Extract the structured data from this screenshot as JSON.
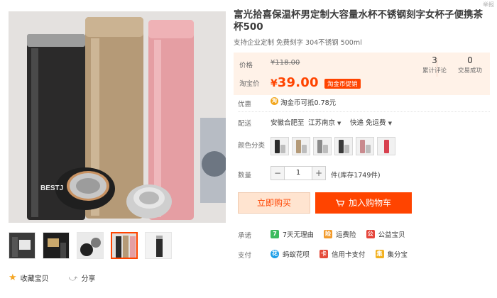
{
  "header": {
    "report_label": "举报"
  },
  "product": {
    "title": "富光拾喜保温杯男定制大容量水杯不锈钢刻字女杯子便携茶杯500",
    "subtitle": "支持企业定制 免费刻字 304不锈钢 500ml",
    "main_image_brand_text": "BESTJ"
  },
  "price": {
    "original_label": "价格",
    "original_value": "¥118.00",
    "current_label": "淘宝价",
    "current_symbol": "¥",
    "current_value": "39.00",
    "promo_tag": "淘金币促销",
    "stats": [
      {
        "count": "3",
        "label": "累计评论"
      },
      {
        "count": "0",
        "label": "交易成功"
      }
    ]
  },
  "promotion": {
    "label": "优惠",
    "coin_glyph": "淘",
    "text": "淘金币可抵0.78元"
  },
  "shipping": {
    "label": "配送",
    "from": "安徽合肥",
    "to_word": "至",
    "destination": "江苏南京",
    "method": "快递",
    "fee": "免运费"
  },
  "color": {
    "label": "颜色分类",
    "swatches": [
      {
        "name": "black",
        "color": "#2a2a2a"
      },
      {
        "name": "gold-open",
        "color": "#b49a78"
      },
      {
        "name": "silver",
        "color": "#8a8a8a"
      },
      {
        "name": "black-open",
        "color": "#3a3a3a"
      },
      {
        "name": "pink-open",
        "color": "#c98a8e"
      },
      {
        "name": "red",
        "color": "#d8414f"
      }
    ]
  },
  "quantity": {
    "label": "数量",
    "minus": "−",
    "value": "1",
    "plus": "+",
    "stock_text": "件(库存1749件)"
  },
  "actions": {
    "buy_now": "立即购买",
    "add_to_cart": "加入购物车"
  },
  "promise": {
    "label": "承诺",
    "items": [
      {
        "icon": "7",
        "icon_color": "#3dbb5e",
        "text": "7天无理由"
      },
      {
        "icon": "险",
        "icon_color": "#f29a2a",
        "text": "运费险"
      },
      {
        "icon": "公",
        "icon_color": "#e5453b",
        "text": "公益宝贝"
      }
    ]
  },
  "payment": {
    "label": "支付",
    "items": [
      {
        "icon": "花",
        "icon_color": "#1e9fe8",
        "text": "蚂蚁花呗"
      },
      {
        "icon": "卡",
        "icon_color": "#e54b3a",
        "text": "信用卡支付"
      },
      {
        "icon": "集",
        "icon_color": "#f2b11f",
        "text": "集分宝"
      }
    ]
  },
  "gallery_actions": {
    "favorite": "收藏宝贝",
    "share": "分享"
  },
  "colors": {
    "accent": "#ff4400",
    "price_bg": "#fff2e8"
  }
}
